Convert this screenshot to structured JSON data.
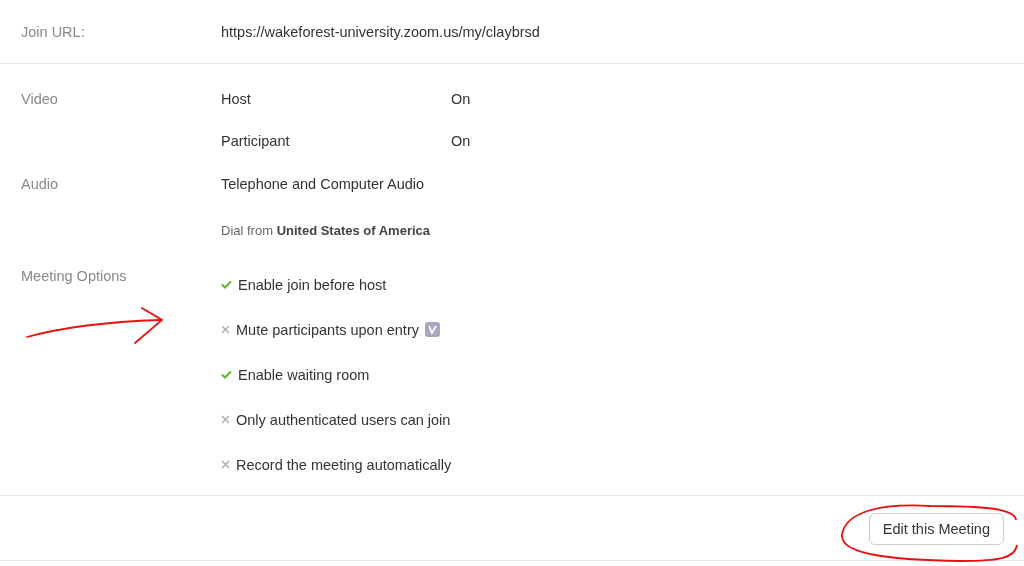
{
  "join_url": {
    "label": "Join URL:",
    "value": "https://wakeforest-university.zoom.us/my/claybrsd"
  },
  "video": {
    "label": "Video",
    "rows": [
      {
        "name": "Host",
        "value": "On"
      },
      {
        "name": "Participant",
        "value": "On"
      }
    ]
  },
  "audio": {
    "label": "Audio",
    "value": "Telephone and Computer Audio",
    "note": "Dial from **United States of America**"
  },
  "meeting_options": {
    "label": "Meeting Options",
    "options": [
      {
        "label": "Enable join before host",
        "enabled": true
      },
      {
        "label": "Mute participants upon entry",
        "enabled": false,
        "badge": true
      },
      {
        "label": "Enable waiting room",
        "enabled": true
      },
      {
        "label": "Only authenticated users can join",
        "enabled": false
      },
      {
        "label": "Record the meeting automatically",
        "enabled": false
      }
    ]
  },
  "edit_button": "Edit this Meeting"
}
